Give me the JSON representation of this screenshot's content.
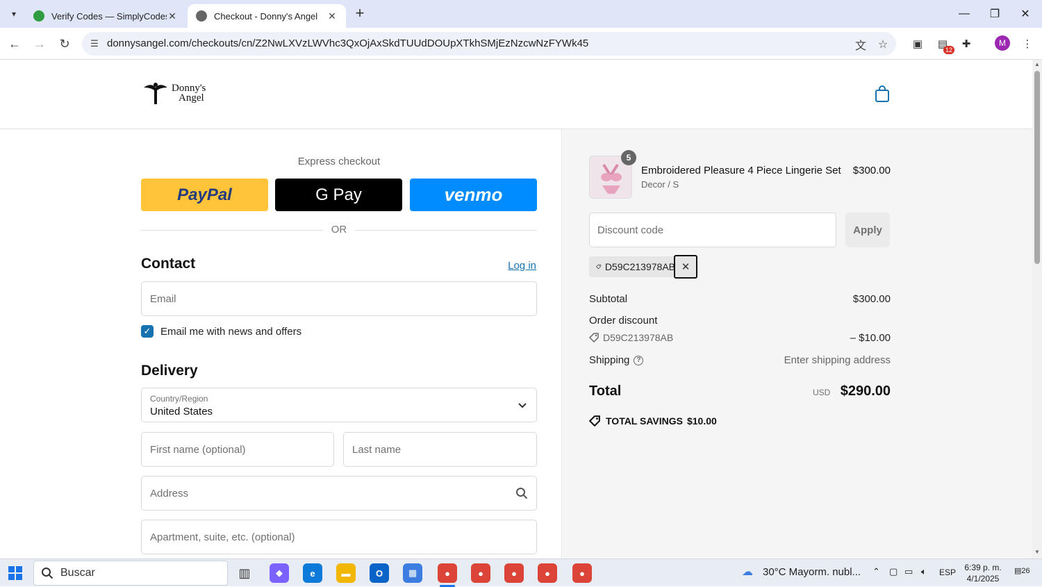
{
  "browser": {
    "tabs": [
      {
        "title": "Verify Codes — SimplyCodes",
        "active": false
      },
      {
        "title": "Checkout - Donny's Angel",
        "active": true
      }
    ],
    "url": "donnysangel.com/checkouts/cn/Z2NwLXVzLWVhc3QxOjAxSkdTUUdDOUpXTkhSMjEzNzcwNzFYWk45",
    "extension_badge": "12",
    "profile_initial": "M"
  },
  "store": {
    "logo_line1": "Donny's",
    "logo_line2": "Angel"
  },
  "checkout": {
    "express_title": "Express checkout",
    "paypal_label": "PayPal",
    "gpay_label": "G Pay",
    "venmo_label": "venmo",
    "or_label": "OR",
    "contact_heading": "Contact",
    "login_label": "Log in",
    "email_placeholder": "Email",
    "newsletter_label": "Email me with news and offers",
    "newsletter_checked": true,
    "delivery_heading": "Delivery",
    "country_label": "Country/Region",
    "country_value": "United States",
    "first_name_placeholder": "First name (optional)",
    "last_name_placeholder": "Last name",
    "address_placeholder": "Address",
    "apartment_placeholder": "Apartment, suite, etc. (optional)"
  },
  "summary": {
    "item": {
      "quantity": "5",
      "name": "Embroidered Pleasure 4 Piece Lingerie Set",
      "variant": "Decor / S",
      "price": "$300.00"
    },
    "discount_placeholder": "Discount code",
    "apply_label": "Apply",
    "applied_code": "D59C213978AB",
    "subtotal_label": "Subtotal",
    "subtotal_value": "$300.00",
    "order_discount_label": "Order discount",
    "discount_code": "D59C213978AB",
    "discount_value": "– $10.00",
    "shipping_label": "Shipping",
    "shipping_value": "Enter shipping address",
    "total_label": "Total",
    "total_currency": "USD",
    "total_value": "$290.00",
    "savings_label": "TOTAL SAVINGS",
    "savings_value": "$10.00"
  },
  "taskbar": {
    "search_label": "Buscar",
    "weather": "30°C  Mayorm. nubl...",
    "language": "ESP",
    "time": "6:39 p. m.",
    "date": "4/1/2025",
    "notifications": "26"
  }
}
